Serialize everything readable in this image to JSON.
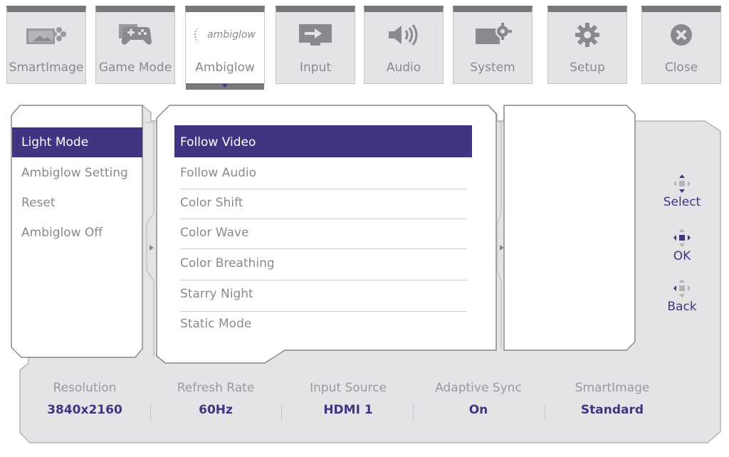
{
  "tabs": [
    {
      "label": "SmartImage",
      "icon": "smartimage-icon"
    },
    {
      "label": "Game Mode",
      "icon": "gamepad-icon"
    },
    {
      "label": "Ambiglow",
      "icon": "ambiglow-logo",
      "logo_text": "ambiglow"
    },
    {
      "label": "Input",
      "icon": "input-icon"
    },
    {
      "label": "Audio",
      "icon": "speaker-icon"
    },
    {
      "label": "System",
      "icon": "system-icon"
    },
    {
      "label": "Setup",
      "icon": "gear-icon"
    },
    {
      "label": "Close",
      "icon": "close-icon"
    }
  ],
  "active_tab": "Ambiglow",
  "left_menu": {
    "items": [
      "Light Mode",
      "Ambiglow Setting",
      "Reset",
      "Ambiglow Off"
    ],
    "selected": "Light Mode"
  },
  "center_menu": {
    "items": [
      "Follow Video",
      "Follow Audio",
      "Color Shift",
      "Color Wave",
      "Color Breathing",
      "Starry Night",
      "Static Mode"
    ],
    "selected": "Follow Video"
  },
  "nav": {
    "select": "Select",
    "ok": "OK",
    "back": "Back"
  },
  "info": {
    "resolution": {
      "label": "Resolution",
      "value": "3840x2160"
    },
    "refresh_rate": {
      "label": "Refresh Rate",
      "value": "60Hz"
    },
    "input_source": {
      "label": "Input Source",
      "value": "HDMI 1"
    },
    "adaptive_sync": {
      "label": "Adaptive Sync",
      "value": "On"
    },
    "smartimage": {
      "label": "SmartImage",
      "value": "Standard"
    }
  },
  "colors": {
    "accent": "#3f3582",
    "panel": "#e4e4e7",
    "tab_top": "#78787c"
  }
}
